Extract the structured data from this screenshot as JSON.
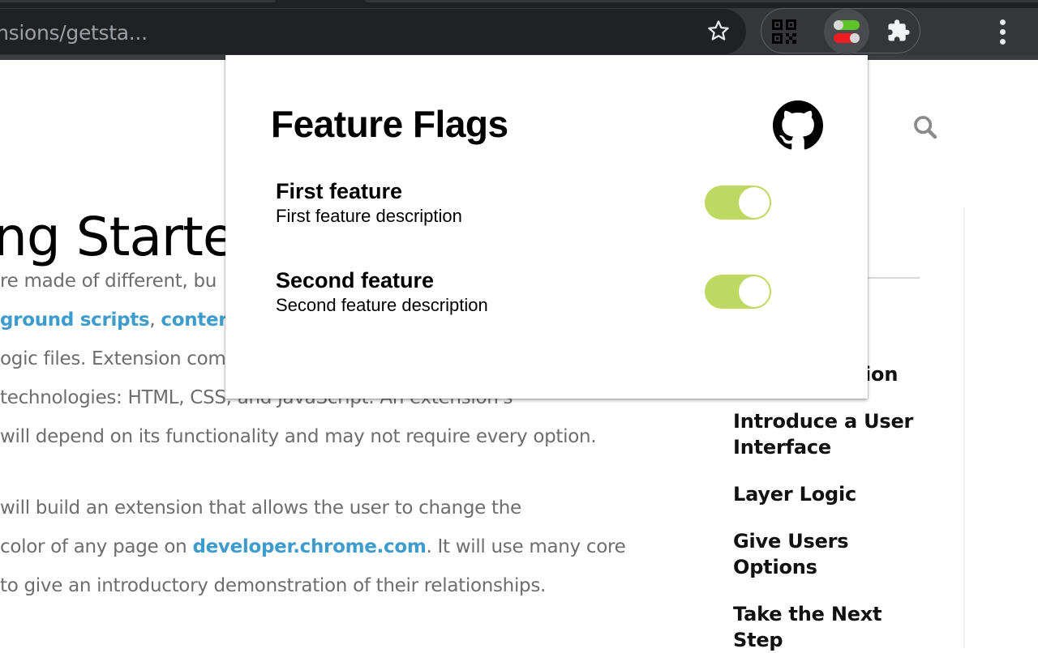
{
  "browser": {
    "url_display": "ensions/getsta...",
    "bookmark_icon": "star-outline-icon",
    "extensions": [
      {
        "name": "QR code",
        "icon": "qr-code-icon"
      },
      {
        "name": "Feature Flags",
        "icon": "toggle-switches-icon",
        "active": true
      },
      {
        "name": "Extensions",
        "icon": "puzzle-icon"
      }
    ],
    "menu_icon": "kebab-menu-icon"
  },
  "page": {
    "title": "ng Starte",
    "search_icon": "search-icon",
    "paragraphs": [
      {
        "segments": [
          {
            "text": "re made of different, bu",
            "link": false
          }
        ]
      },
      {
        "segments": [
          {
            "text": "ground scripts",
            "link": true
          },
          {
            "text": ", ",
            "link": false
          },
          {
            "text": "conter",
            "link": true
          }
        ]
      },
      {
        "segments": [
          {
            "text": "ogic files. Extension components are created with web",
            "link": false
          }
        ]
      },
      {
        "segments": [
          {
            "text": " technologies: HTML, CSS, and JavaScript. An extension's",
            "link": false
          }
        ]
      },
      {
        "segments": [
          {
            "text": "will depend on its functionality and may not require every option.",
            "link": false
          }
        ]
      },
      {
        "segments": [
          {
            "text": "will build an extension that allows the user to change the",
            "link": false
          }
        ]
      },
      {
        "segments": [
          {
            "text": "color of any page on ",
            "link": false
          },
          {
            "text": "developer.chrome.com",
            "link": true
          },
          {
            "text": ". It will use many core",
            "link": false
          }
        ]
      },
      {
        "segments": [
          {
            "text": "to give an introductory demonstration of their relationships.",
            "link": false
          }
        ]
      }
    ],
    "toc": [
      "ion",
      "Introduce a User Interface",
      "Layer Logic",
      "Give Users Options",
      "Take the Next Step"
    ]
  },
  "popup": {
    "title": "Feature Flags",
    "github_icon": "github-icon",
    "features": [
      {
        "name": "First feature",
        "description": "First feature description",
        "enabled": true
      },
      {
        "name": "Second feature",
        "description": "Second feature description",
        "enabled": true
      }
    ],
    "accent_color": "#bed962"
  }
}
